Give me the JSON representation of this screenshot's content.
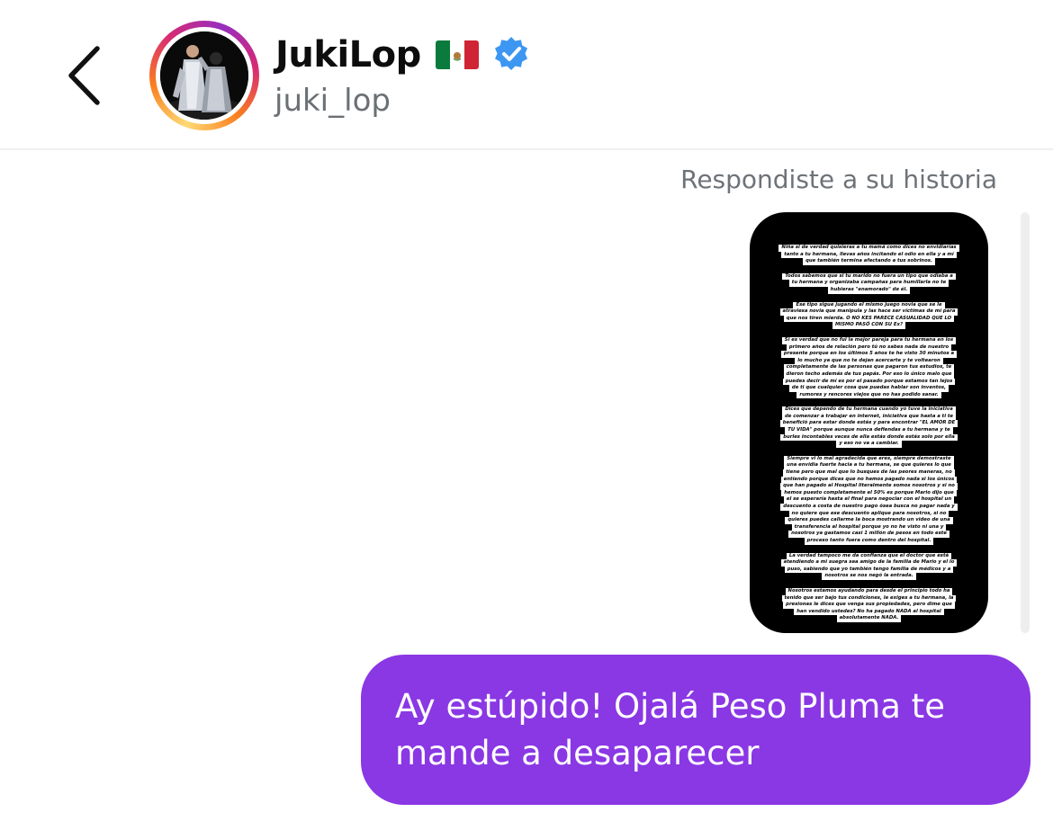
{
  "header": {
    "display_name": "JukiLop",
    "username": "juki_lop",
    "flag_icon": "mexico-flag-icon",
    "verified_icon": "verified-badge-icon",
    "back_icon": "chevron-left-icon",
    "ring_colors": [
      "#feda75",
      "#fa7e1e",
      "#d62976",
      "#962fbf"
    ],
    "verified_color": "#3d97f2"
  },
  "thread": {
    "reply_label": "Respondiste a su historia",
    "story_text_blocks": [
      [
        "Niña si de verdad quisieras a tu mamá como dices no envidiarías",
        "tanto a tu hermana, llevas años incitando el odio en ella y a mí",
        "que también termina afectando a tus sobrinos."
      ],
      [
        "Todos sabemos que si tu marido no fuera un tipo que odiaba a",
        "tu hermana y organizaba campañas para humillarla no te",
        "hubieras \"enamorado\" de él."
      ],
      [
        "Ese tipo sigue jugando el mismo juego novia que se le",
        "atraviesa novia que manipula y las hace ser víctimas de mí para",
        "que nos tiren mierda. O NO KES PARECE CASUALIDAD QUE LO",
        "MISMO PASÓ CON SU Ex?"
      ],
      [
        "Si es verdad que no fui la mejor pareja para tu hermana en los",
        "primero años de relación pero tú no sabes nada de nuestro",
        "presente porque en los últimos 5 años te he visto 30 minutos a",
        "lo mucho ya que no te dejan acercarte y te voltearon",
        "completamente de las personas que pagaron tus estudios, te",
        "dieron techo además de tus papás. Por eso lo único malo que",
        "puedes decir de mí es por el pasado porque estamos tan lejos",
        "de ti que cualquier cosa que puedas hablar son inventos,",
        "rumores y rencores viejos que no has podido sanar."
      ],
      [
        "Dices que dependo de tu hermana cuando yo tuve la iniciativa",
        "de comenzar a trabajar en internet, iniciativa que hasta a ti te",
        "benefició para estar donde estás y para encontrar \"EL AMOR DE",
        "TU VIDA\" porque aunque nunca defiendas a tu hermana y te",
        "burles incontables veces de ella estás donde estás solo por ella",
        "y eso no va a cambiar."
      ],
      [
        "Siempre vi lo mal agradecida que eres, siempre demostraste",
        "una envidia fuerte hacia a tu hermana, se que quieres lo que",
        "tiene pero que mal que lo busques de las peores maneras, no",
        "entiendo porque dices que no hemos pagado nada si los únicos",
        "que han pagado al Hospital literalmente somos nosotros y si no",
        "hemos puesto completamente el 50% es porque Mario dijo que",
        "el se esperaría hasta el final para negociar con el hospital un",
        "descuento a costa de nuestro pago ósea busca no pagar nada y",
        "no quiere que ese descuento aplique para nosotros, si no",
        "quieres puedes callarme la boca mostrando un video de una",
        "transferencia al hospital porque yo no he visto ni una y",
        "nosotros ya gastamos casi 1 millón de pesos en todo este",
        "proceso tanto fuera como dentro del hospital."
      ],
      [
        "La verdad tampoco me da confianza que el doctor que está",
        "atendiendo a mi suegra sea amigo de la familia de Mario y el lo",
        "puso, sabiendo que yo también tengo familia de médicos y a",
        "nosotros se nos negó la entrada."
      ],
      [
        "Nosotros estamos ayudando para desde el principio todo ha",
        "tenido que ser bajo tus condiciones, le exiges a tu hermana, la",
        "presionas le dices que venga sus propiedades, pero dime que",
        "han vendido ustedes? No ha pagado NADA al hospital",
        "absolutamente NADA."
      ]
    ],
    "message_text": "Ay estúpido! Ojalá Peso Pluma te mande a desaparecer",
    "bubble_color": "#8a37e4"
  }
}
